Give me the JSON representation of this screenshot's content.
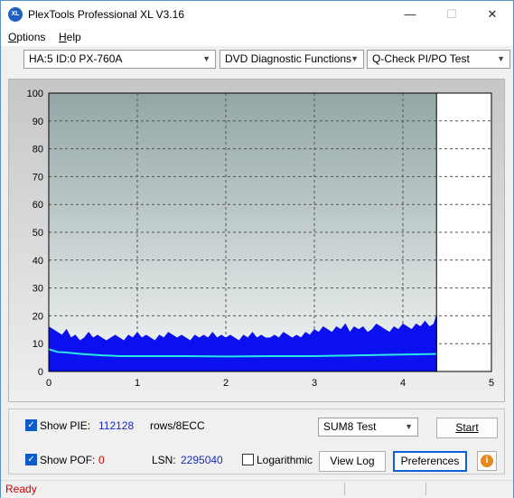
{
  "app": {
    "title": "PlexTools Professional XL V3.16",
    "icon_text": "XL"
  },
  "window_controls": {
    "minimize": "—",
    "maximize": "☐",
    "close": "✕"
  },
  "menu": [
    {
      "label": "Options",
      "accel": "O",
      "rest": "ptions"
    },
    {
      "label": "Help",
      "accel": "H",
      "rest": "elp"
    }
  ],
  "toolbar": {
    "drive": "HA:5 ID:0  PX-760A",
    "function": "DVD Diagnostic Functions",
    "test": "Q-Check PI/PO Test"
  },
  "chart_data": {
    "type": "area",
    "title": "",
    "xlabel": "",
    "ylabel": "",
    "xlim": [
      0,
      5
    ],
    "ylim": [
      0,
      100
    ],
    "x_ticks": [
      "0",
      "1",
      "2",
      "3",
      "4",
      "5"
    ],
    "y_ticks": [
      "0",
      "10",
      "20",
      "30",
      "40",
      "50",
      "60",
      "70",
      "80",
      "90",
      "100"
    ],
    "grid": true,
    "data_end_x": 4.38,
    "series": [
      {
        "color": "#0a10ee",
        "x": [
          0,
          0.05,
          0.1,
          0.15,
          0.2,
          0.25,
          0.3,
          0.35,
          0.4,
          0.45,
          0.5,
          0.55,
          0.6,
          0.65,
          0.7,
          0.75,
          0.8,
          0.85,
          0.9,
          0.95,
          1.0,
          1.05,
          1.1,
          1.15,
          1.2,
          1.25,
          1.3,
          1.35,
          1.4,
          1.45,
          1.5,
          1.55,
          1.6,
          1.65,
          1.7,
          1.75,
          1.8,
          1.85,
          1.9,
          1.95,
          2.0,
          2.05,
          2.1,
          2.15,
          2.2,
          2.25,
          2.3,
          2.35,
          2.4,
          2.45,
          2.5,
          2.55,
          2.6,
          2.65,
          2.7,
          2.75,
          2.8,
          2.85,
          2.9,
          2.95,
          3.0,
          3.05,
          3.1,
          3.15,
          3.2,
          3.25,
          3.3,
          3.35,
          3.4,
          3.45,
          3.5,
          3.55,
          3.6,
          3.65,
          3.7,
          3.75,
          3.8,
          3.85,
          3.9,
          3.95,
          4.0,
          4.05,
          4.1,
          4.15,
          4.2,
          4.25,
          4.3,
          4.35,
          4.38
        ],
        "y": [
          16,
          15,
          14,
          13,
          15,
          12,
          13,
          11,
          12,
          14,
          12,
          13,
          12,
          11,
          12,
          13,
          12,
          11,
          13,
          12,
          14,
          12,
          13,
          12,
          11,
          13,
          12,
          14,
          13,
          12,
          13,
          12,
          11,
          13,
          12,
          13,
          12,
          14,
          12,
          13,
          12,
          13,
          12,
          11,
          13,
          12,
          14,
          12,
          13,
          12,
          12,
          13,
          12,
          14,
          13,
          12,
          13,
          12,
          14,
          13,
          15,
          14,
          16,
          15,
          14,
          16,
          15,
          17,
          14,
          16,
          15,
          16,
          14,
          15,
          17,
          16,
          15,
          14,
          16,
          15,
          17,
          16,
          15,
          17,
          16,
          18,
          16,
          17,
          20
        ]
      },
      {
        "color": "#29e6e6",
        "x": [
          0,
          0.05,
          0.1,
          0.2,
          0.3,
          0.4,
          0.5,
          0.6,
          0.7,
          0.8,
          1.0,
          1.5,
          2.0,
          2.5,
          3.0,
          3.5,
          4.0,
          4.38
        ],
        "y": [
          8,
          7.5,
          7,
          6.8,
          6.5,
          6.2,
          6,
          5.8,
          5.7,
          5.5,
          5.5,
          5.5,
          5.4,
          5.5,
          5.5,
          5.8,
          6.1,
          6.3
        ]
      }
    ]
  },
  "controls": {
    "show_pie_label": "Show PIE:",
    "pie_value": "112128",
    "pie_unit": "rows/8ECC",
    "show_pof_label": "Show POF:",
    "pof_value": "0",
    "lsn_label": "LSN:",
    "lsn_value": "2295040",
    "logarithmic_label": "Logarithmic",
    "test_select": "SUM8 Test",
    "start_button": "Start",
    "view_log_button": "View Log",
    "preferences_button": "Preferences",
    "show_pie_checked": true,
    "show_pof_checked": true,
    "logarithmic_checked": false
  },
  "status": {
    "text": "Ready"
  }
}
